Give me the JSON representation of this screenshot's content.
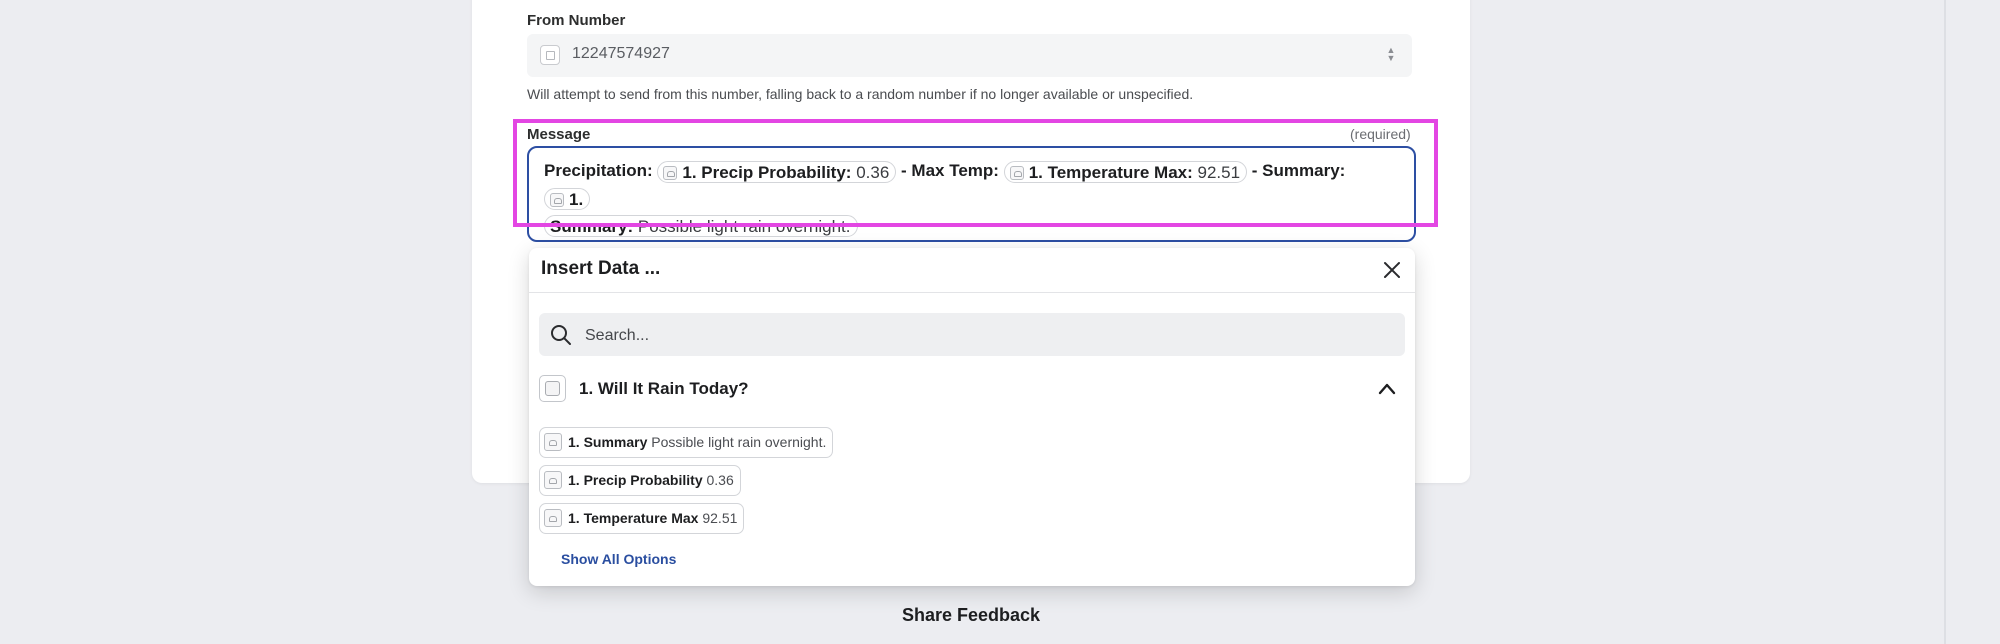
{
  "form": {
    "from_number": {
      "label": "From Number",
      "value": "12247574927",
      "helper": "Will attempt to send from this number, falling back to a random number if no longer available or unspecified."
    },
    "message": {
      "label": "Message",
      "required_label": "(required)",
      "content": {
        "prefix_1": "Precipitation:",
        "pill_1_key": "1. Precip Probability:",
        "pill_1_value": "0.36",
        "prefix_2": "- Max Temp:",
        "pill_2_key": "1. Temperature Max:",
        "pill_2_value": "92.51",
        "prefix_3": "- Summary:",
        "pill_3_key_line1": "1.",
        "pill_3_key_line2": "Summary:",
        "pill_3_value": "Possible light rain overnight."
      }
    }
  },
  "insert_data": {
    "title": "Insert Data ...",
    "search_placeholder": "Search...",
    "group": {
      "title": "1. Will It Rain Today?",
      "expanded": true
    },
    "options": [
      {
        "key": "1. Summary",
        "value": "Possible light rain overnight."
      },
      {
        "key": "1. Precip Probability",
        "value": "0.36"
      },
      {
        "key": "1. Temperature Max",
        "value": "92.51"
      }
    ],
    "show_all_label": "Show All Options"
  },
  "footer": {
    "feedback_label": "Share Feedback"
  },
  "colors": {
    "highlight": "#e346e3",
    "focus_border": "#2d4fa3",
    "link": "#2a4ea0",
    "background": "#ecedf1"
  },
  "icons": [
    "phone-number-icon",
    "select-arrows-icon",
    "app-cloud-icon",
    "close-icon",
    "search-icon",
    "chevron-up-icon"
  ]
}
